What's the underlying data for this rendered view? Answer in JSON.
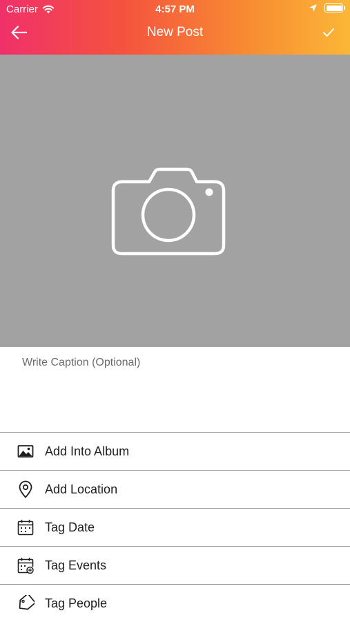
{
  "status_bar": {
    "carrier": "Carrier",
    "time": "4:57 PM",
    "battery_level": 1.0
  },
  "nav": {
    "title": "New Post",
    "back_icon": "arrow-left-icon",
    "confirm_icon": "checkmark-icon"
  },
  "photo": {
    "icon": "camera-icon",
    "background": "#a2a2a2"
  },
  "caption": {
    "value": "",
    "placeholder": "Write Caption (Optional)"
  },
  "options": [
    {
      "label": "Add Into Album",
      "icon": "image-icon"
    },
    {
      "label": "Add Location",
      "icon": "map-pin-icon"
    },
    {
      "label": "Tag Date",
      "icon": "calendar-icon"
    },
    {
      "label": "Tag Events",
      "icon": "calendar-add-icon"
    },
    {
      "label": "Tag People",
      "icon": "tag-icon"
    }
  ],
  "colors": {
    "header_gradient": [
      "#f0306a",
      "#f4533f",
      "#f88a32",
      "#fbb737"
    ],
    "text": "#1e1e1e",
    "divider": "#9a9a9a"
  }
}
